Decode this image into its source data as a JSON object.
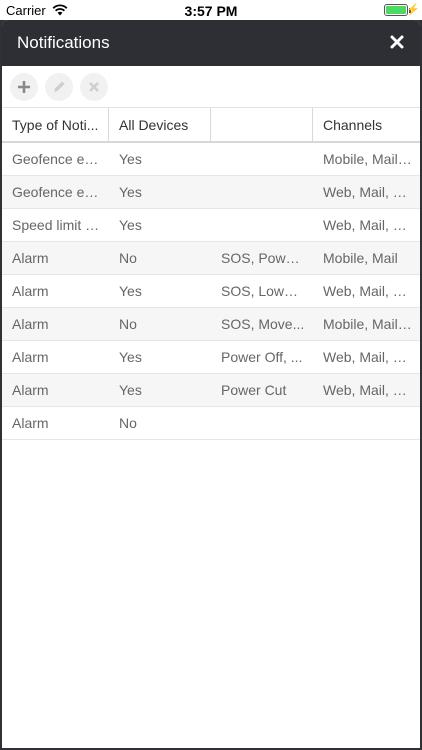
{
  "status_bar": {
    "carrier": "Carrier",
    "time": "3:57 PM",
    "battery_level": 1.0
  },
  "header": {
    "title": "Notifications",
    "close_icon": "close-icon"
  },
  "toolbar": {
    "buttons": [
      {
        "icon": "plus-icon"
      },
      {
        "icon": "pencil-icon"
      },
      {
        "icon": "x-icon"
      }
    ]
  },
  "table": {
    "columns": [
      "Type of Noti...",
      "All Devices",
      "",
      "Channels"
    ],
    "rows": [
      [
        "Geofence ex...",
        "Yes",
        "",
        "Mobile, Mail,..."
      ],
      [
        "Geofence en...",
        "Yes",
        "",
        "Web, Mail, M..."
      ],
      [
        "Speed limit e...",
        "Yes",
        "",
        "Web, Mail, M..."
      ],
      [
        "Alarm",
        "No",
        "SOS, Power ...",
        "Mobile, Mail"
      ],
      [
        "Alarm",
        "Yes",
        "SOS, LowBa...",
        "Web, Mail, M..."
      ],
      [
        "Alarm",
        "No",
        "SOS, Move...",
        "Mobile, Mail,..."
      ],
      [
        "Alarm",
        "Yes",
        "Power Off, ...",
        "Web, Mail, M..."
      ],
      [
        "Alarm",
        "Yes",
        "Power Cut",
        "Web, Mail, M..."
      ],
      [
        "Alarm",
        "No",
        "",
        ""
      ]
    ]
  },
  "colors": {
    "header_bg": "#2d2f35",
    "alt_row_bg": "#f6f6f6",
    "battery": "#4cd964"
  }
}
